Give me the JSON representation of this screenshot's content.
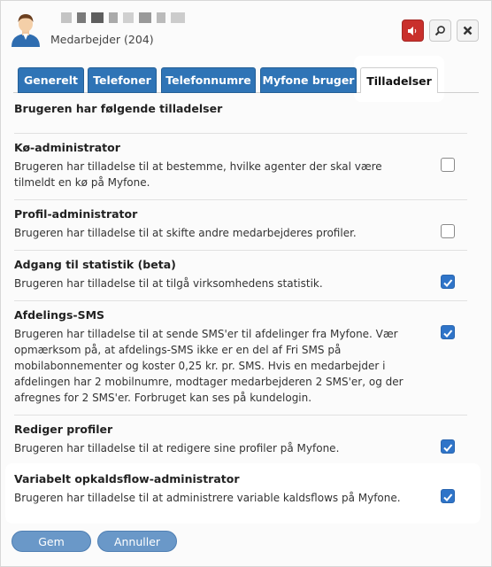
{
  "header": {
    "subtitle": "Medarbejder (204)",
    "icons": {
      "speaker": "speaker-mute-icon",
      "search": "search-icon",
      "close": "close-icon",
      "avatar": "user-avatar-icon"
    },
    "colors": {
      "danger": "#c9302c",
      "accent": "#2f74b6"
    }
  },
  "tabs": [
    {
      "label": "Generelt",
      "active": false
    },
    {
      "label": "Telefoner",
      "active": false
    },
    {
      "label": "Telefonnumre",
      "active": false
    },
    {
      "label": "Myfone bruger",
      "active": false
    },
    {
      "label": "Tilladelser",
      "active": true
    }
  ],
  "section_title": "Brugeren har følgende tilladelser",
  "permissions": [
    {
      "title": "Kø-administrator",
      "lines": [
        "Brugeren har tilladelse til at bestemme, hvilke agenter der skal være",
        "tilmeldt en kø på Myfone."
      ],
      "checked": false
    },
    {
      "title": "Profil-administrator",
      "lines": [
        "Brugeren har tilladelse til at skifte andre medarbejderes profiler."
      ],
      "checked": false
    },
    {
      "title": "Adgang til statistik (beta)",
      "lines": [
        "Brugeren har tilladelse til at tilgå virksomhedens statistik."
      ],
      "checked": true
    },
    {
      "title": "Afdelings-SMS",
      "lines": [
        "Brugeren har tilladelse til at sende SMS'er til afdelinger fra Myfone. Vær",
        "opmærksom på, at afdelings-SMS ikke er en del af Fri SMS på",
        "mobilabonnementer og koster 0,25 kr. pr. SMS. Hvis en medarbejder i",
        "afdelingen har 2 mobilnumre, modtager medarbejderen 2 SMS'er, og der",
        "afregnes for 2 SMS'er. Forbruget kan ses på kundelogin."
      ],
      "checked": true
    },
    {
      "title": "Rediger profiler",
      "lines": [
        "Brugeren har tilladelse til at redigere sine profiler på Myfone."
      ],
      "checked": true
    },
    {
      "title": "Variabelt opkaldsflow-administrator",
      "lines": [
        "Brugeren har tilladelse til at administrere variable kaldsflows på Myfone."
      ],
      "checked": true
    }
  ],
  "footer": {
    "save_label": "Gem",
    "cancel_label": "Annuller"
  }
}
